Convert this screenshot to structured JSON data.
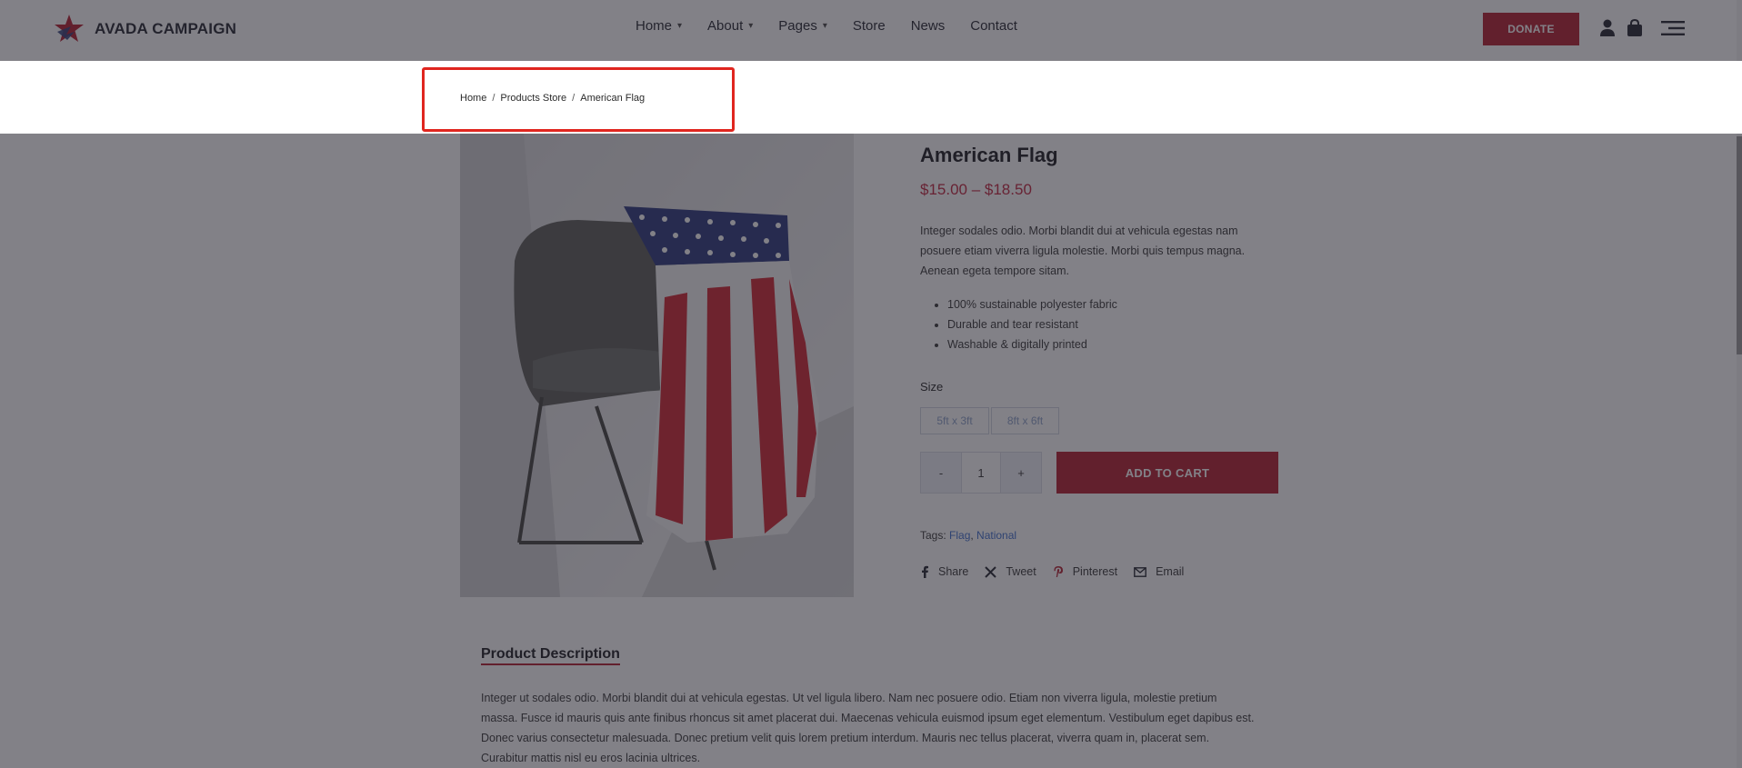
{
  "header": {
    "logo_text": "AVADA CAMPAIGN",
    "nav": [
      {
        "label": "Home",
        "has_dropdown": true
      },
      {
        "label": "About",
        "has_dropdown": true
      },
      {
        "label": "Pages",
        "has_dropdown": true
      },
      {
        "label": "Store",
        "has_dropdown": false
      },
      {
        "label": "News",
        "has_dropdown": false
      },
      {
        "label": "Contact",
        "has_dropdown": false
      }
    ],
    "donate_label": "DONATE",
    "icons": [
      "user-icon",
      "shopping-bag-icon",
      "menu-icon"
    ]
  },
  "breadcrumb": {
    "items": [
      "Home",
      "Products Store",
      "American Flag"
    ],
    "separator": "/"
  },
  "product": {
    "title": "American Flag",
    "price": "$15.00 – $18.50",
    "description": "Integer sodales odio. Morbi blandit dui at vehicula egestas nam posuere etiam viverra ligula molestie. Morbi quis tempus magna. Aenean egeta tempore sitam.",
    "features": [
      "100% sustainable polyester fabric",
      "Durable and tear resistant",
      "Washable & digitally printed"
    ],
    "size_label": "Size",
    "sizes": [
      "5ft x 3ft",
      "8ft x 6ft"
    ],
    "quantity": {
      "minus": "-",
      "value": "1",
      "plus": "+"
    },
    "add_to_cart_label": "ADD TO CART",
    "tags_label": "Tags:",
    "tags": [
      "Flag",
      "National"
    ],
    "share": [
      {
        "label": "Share",
        "icon": "facebook-icon"
      },
      {
        "label": "Tweet",
        "icon": "x-icon"
      },
      {
        "label": "Pinterest",
        "icon": "pinterest-icon"
      },
      {
        "label": "Email",
        "icon": "email-icon"
      }
    ]
  },
  "description_section": {
    "title": "Product Description",
    "text": "Integer ut sodales odio. Morbi blandit dui at vehicula egestas. Ut vel ligula libero. Nam nec posuere odio. Etiam non viverra ligula, molestie pretium massa. Fusce id mauris quis ante finibus rhoncus sit amet placerat dui. Maecenas vehicula euismod ipsum eget elementum. Vestibulum eget dapibus est. Donec varius consectetur malesuada. Donec pretium velit quis lorem pretium interdum. Mauris nec tellus placerat, viverra quam in, placerat sem. Curabitur mattis nisl eu eros lacinia ultrices."
  },
  "colors": {
    "accent": "#b3182a",
    "highlight": "#e0261f",
    "link": "#3a6ccc",
    "price": "#c0203a"
  }
}
